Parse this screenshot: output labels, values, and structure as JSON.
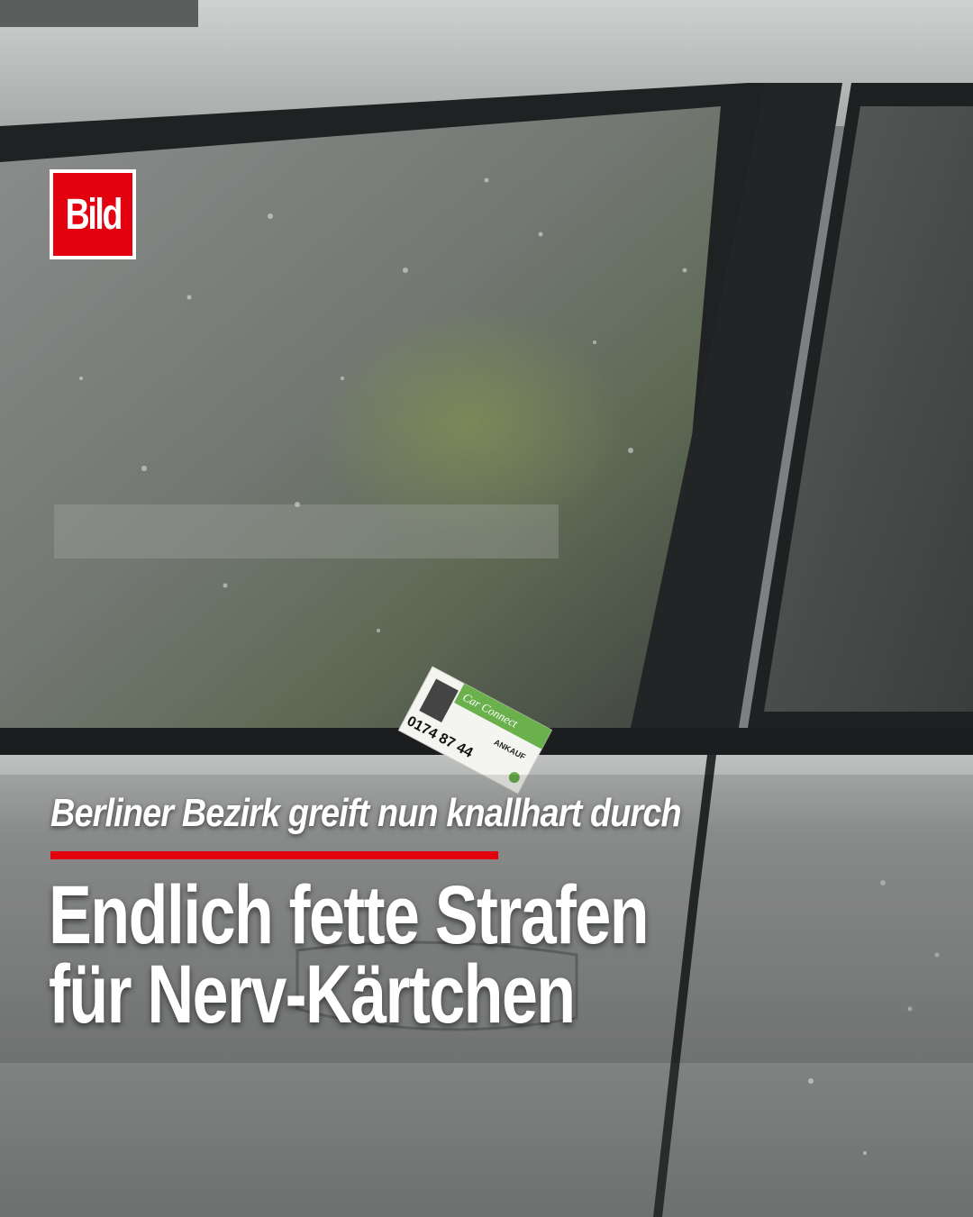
{
  "logo": {
    "text": "Bild"
  },
  "card": {
    "brand": "Car Connect",
    "phone": "0174 87 44",
    "tag": "ANKAUF"
  },
  "kicker": "Berliner Bezirk greift nun knallhart durch",
  "headline": {
    "line1": "Endlich fette Strafen",
    "line2": "für Nerv-Kärtchen"
  },
  "colors": {
    "accent": "#e3000f",
    "text": "#ffffff",
    "card_green": "#6ab04c"
  }
}
